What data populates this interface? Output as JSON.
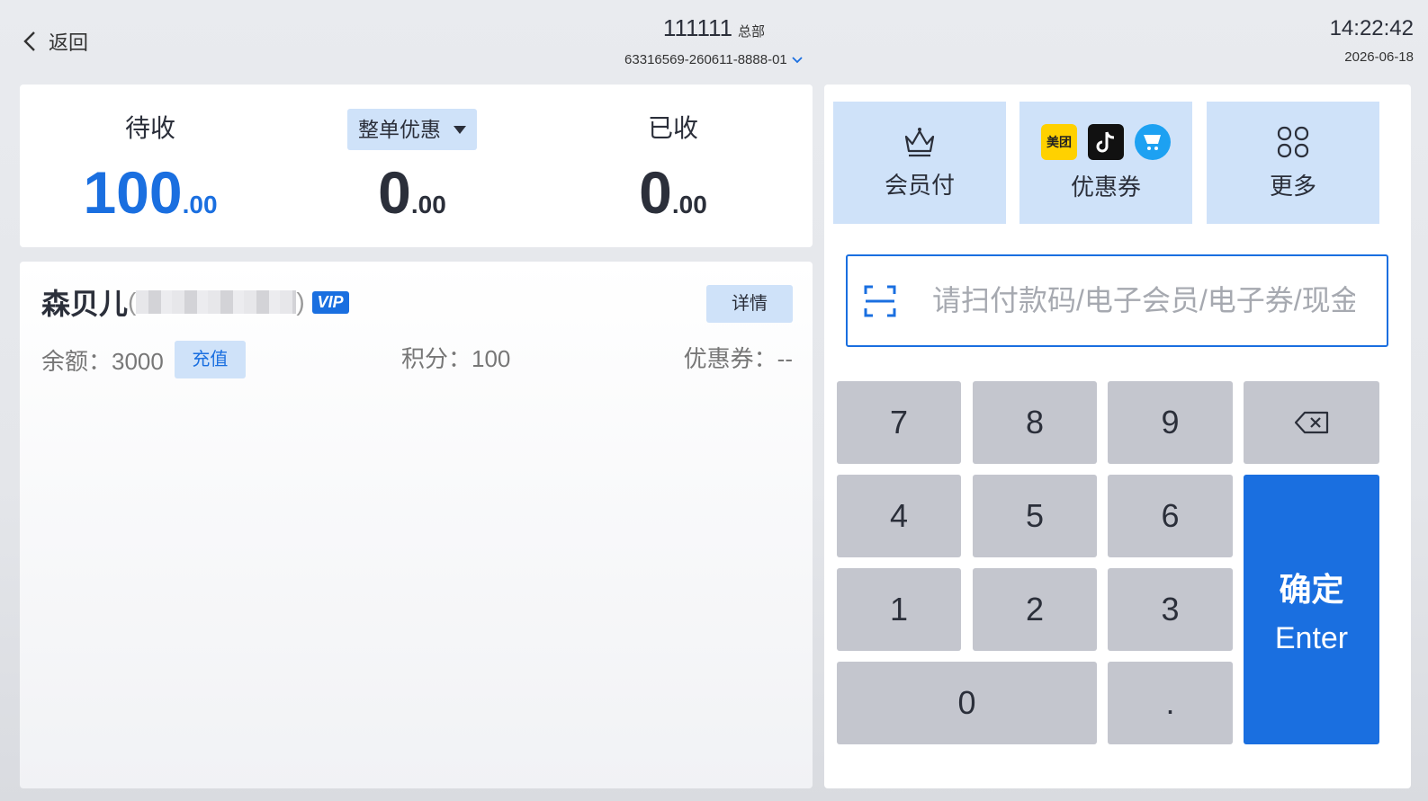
{
  "header": {
    "back_label": "返回",
    "store_name": "111111",
    "store_tag": "总部",
    "order_no": "63316569-260611-8888-01",
    "time": "14:22:42",
    "date": "2026-06-18"
  },
  "summary": {
    "pending_label": "待收",
    "pending_int": "100",
    "pending_dec": ".00",
    "discount_label": "整单优惠",
    "discount_int": "0",
    "discount_dec": ".00",
    "received_label": "已收",
    "received_int": "0",
    "received_dec": ".00"
  },
  "member": {
    "name": "森贝儿",
    "paren_open": "(",
    "paren_close": ")",
    "vip_label": "VIP",
    "detail_label": "详情",
    "balance_label": "余额：3000",
    "recharge_label": "充值",
    "points_label": "积分：100",
    "coupon_label": "优惠券：--"
  },
  "payment": {
    "member_pay_label": "会员付",
    "coupon_label": "优惠券",
    "meituan_label": "美团",
    "more_label": "更多",
    "scan_placeholder": "请扫付款码/电子会员/电子券/现金券"
  },
  "keypad": {
    "k7": "7",
    "k8": "8",
    "k9": "9",
    "k4": "4",
    "k5": "5",
    "k6": "6",
    "k1": "1",
    "k2": "2",
    "k3": "3",
    "k0": "0",
    "kdot": ".",
    "confirm_zh": "确定",
    "confirm_en": "Enter"
  },
  "colors": {
    "accent": "#1a6fe0",
    "tile_bg": "#cfe2f9",
    "key_bg": "#c4c6ce",
    "page_bg": "#e6e8ec"
  }
}
